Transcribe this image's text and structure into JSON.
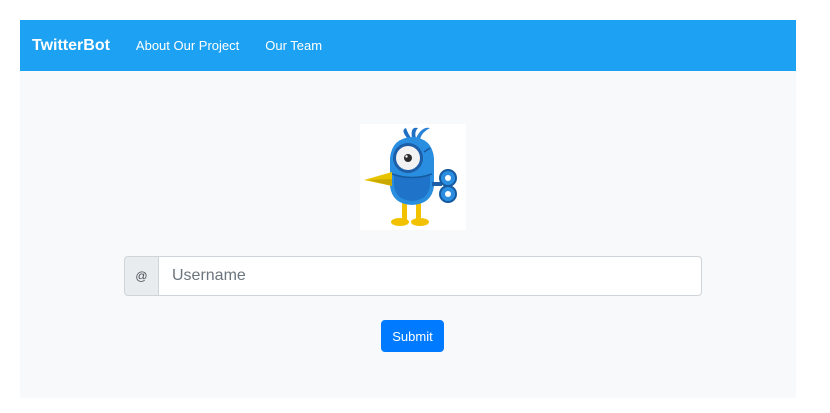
{
  "navbar": {
    "brand": "TwitterBot",
    "links": [
      "About Our Project",
      "Our Team"
    ],
    "color": "#1da1f2"
  },
  "logo": {
    "icon": "robot-bird-icon"
  },
  "form": {
    "prepend": "@",
    "placeholder": "Username",
    "value": "",
    "submit_label": "Submit",
    "button_color": "#007bff"
  }
}
